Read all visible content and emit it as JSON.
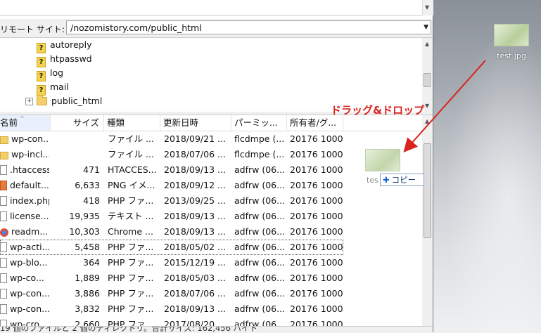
{
  "remote": {
    "label": "リモート サイト:",
    "path": "/nozomistory.com/public_html"
  },
  "tree": {
    "items": [
      {
        "label": "autoreply",
        "icon": "unknown-folder-icon"
      },
      {
        "label": "htpasswd",
        "icon": "unknown-folder-icon"
      },
      {
        "label": "log",
        "icon": "unknown-folder-icon"
      },
      {
        "label": "mail",
        "icon": "unknown-folder-icon"
      },
      {
        "label": "public_html",
        "icon": "folder-icon",
        "expander": "+"
      }
    ]
  },
  "columns": {
    "name": "名前",
    "size": "サイズ",
    "type": "種類",
    "modified": "更新日時",
    "perms": "パーミッ...",
    "owner": "所有者/グ..."
  },
  "files": [
    {
      "name": "wp-con...",
      "size": "",
      "type": "ファイル ...",
      "modified": "2018/09/21 ...",
      "perms": "flcdmpe (...",
      "owner": "20176 1000",
      "icon": "folder"
    },
    {
      "name": "wp-incl...",
      "size": "",
      "type": "ファイル ...",
      "modified": "2018/07/06 ...",
      "perms": "flcdmpe (...",
      "owner": "20176 1000",
      "icon": "folder"
    },
    {
      "name": ".htaccess",
      "size": "471",
      "type": "HTACCES...",
      "modified": "2018/09/13 ...",
      "perms": "adfrw (06...",
      "owner": "20176 1000",
      "icon": "file"
    },
    {
      "name": "default....",
      "size": "6,633",
      "type": "PNG イメ...",
      "modified": "2018/09/12 ...",
      "perms": "adfrw (06...",
      "owner": "20176 1000",
      "icon": "png"
    },
    {
      "name": "index.php",
      "size": "418",
      "type": "PHP ファ...",
      "modified": "2013/09/25 ...",
      "perms": "adfrw (06...",
      "owner": "20176 1000",
      "icon": "file"
    },
    {
      "name": "license....",
      "size": "19,935",
      "type": "テキスト ...",
      "modified": "2018/09/13 ...",
      "perms": "adfrw (06...",
      "owner": "20176 1000",
      "icon": "file"
    },
    {
      "name": "readm...",
      "size": "10,303",
      "type": "Chrome ...",
      "modified": "2018/09/13 ...",
      "perms": "adfrw (06...",
      "owner": "20176 1000",
      "icon": "chrome"
    },
    {
      "name": "wp-acti...",
      "size": "5,458",
      "type": "PHP ファ...",
      "modified": "2018/05/02 ...",
      "perms": "adfrw (06...",
      "owner": "20176 1000",
      "icon": "file"
    },
    {
      "name": "wp-blo...",
      "size": "364",
      "type": "PHP ファ...",
      "modified": "2015/12/19 ...",
      "perms": "adfrw (06...",
      "owner": "20176 1000",
      "icon": "file"
    },
    {
      "name": "wp-co...",
      "size": "1,889",
      "type": "PHP ファ...",
      "modified": "2018/05/03 ...",
      "perms": "adfrw (06...",
      "owner": "20176 1000",
      "icon": "file"
    },
    {
      "name": "wp-con...",
      "size": "3,886",
      "type": "PHP ファ...",
      "modified": "2018/07/06 ...",
      "perms": "adfrw (06...",
      "owner": "20176 1000",
      "icon": "file"
    },
    {
      "name": "wp-con...",
      "size": "3,832",
      "type": "PHP ファ...",
      "modified": "2018/09/13 ...",
      "perms": "adfrw (06...",
      "owner": "20176 1000",
      "icon": "file"
    },
    {
      "name": "wp-cro...",
      "size": "2,660",
      "type": "PHP ファ...",
      "modified": "2017/08/20 ...",
      "perms": "adfrw (06...",
      "owner": "20176 1000",
      "icon": "file"
    }
  ],
  "status": "19 個のファイルと 2 個のディレクトリ。合計サイズ: 162,456 バイト",
  "desktop": {
    "file_label": "test.jpg",
    "drag_label": "tes"
  },
  "drag": {
    "copy_label": "コピー",
    "annotation": "ドラッグ&ドロップ",
    "annotation_color": "#d8231f"
  }
}
